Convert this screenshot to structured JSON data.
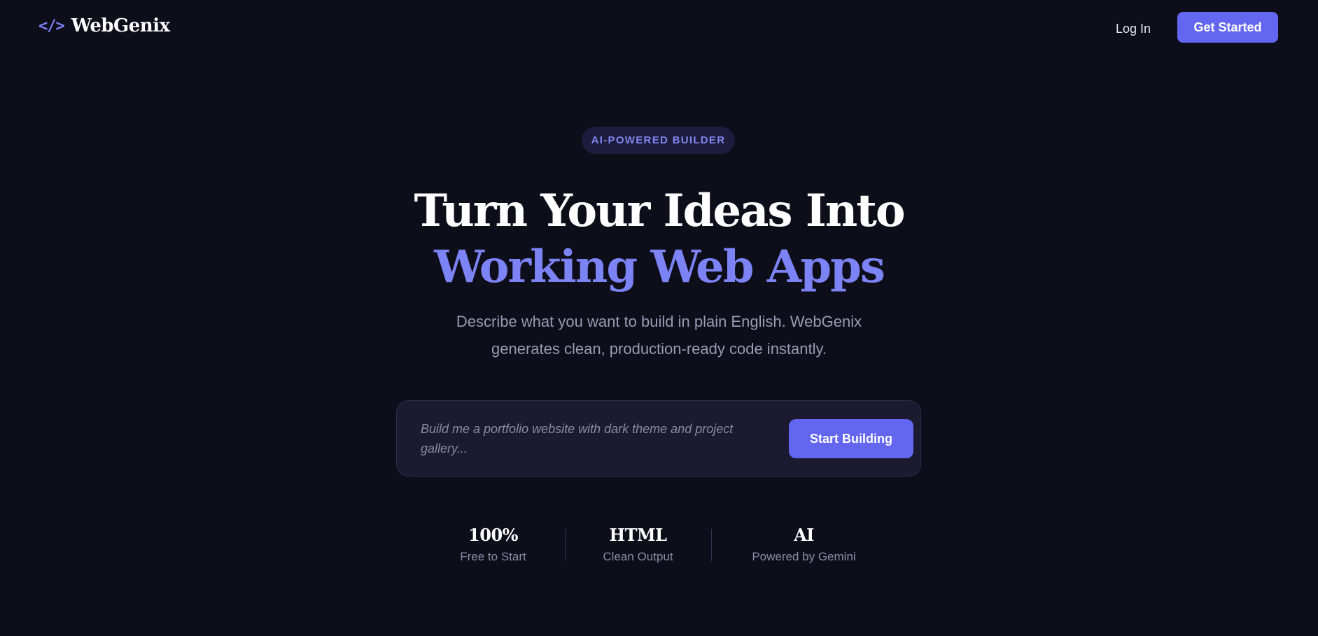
{
  "nav": {
    "brand_icon": "</>",
    "brand_name": "WebGenix",
    "login_label": "Log In",
    "cta_label": "Get Started"
  },
  "hero": {
    "badge": "AI-POWERED BUILDER",
    "headline_line1": "Turn Your Ideas Into",
    "headline_line2": "Working Web Apps",
    "subtext_line1": "Describe what you want to build in plain English. WebGenix",
    "subtext_line2": "generates clean, production-ready code instantly."
  },
  "prompt": {
    "placeholder": "Build me a portfolio website with dark theme and project gallery...",
    "button_label": "Start Building"
  },
  "stats": [
    {
      "value": "100%",
      "label": "Free to Start"
    },
    {
      "value": "HTML",
      "label": "Clean Output"
    },
    {
      "value": "AI",
      "label": "Powered by Gemini"
    }
  ],
  "colors": {
    "background": "#0e0d1a",
    "accent": "#6366f1",
    "accent_text": "#7c83f5",
    "muted_text": "#9a9ab4"
  }
}
